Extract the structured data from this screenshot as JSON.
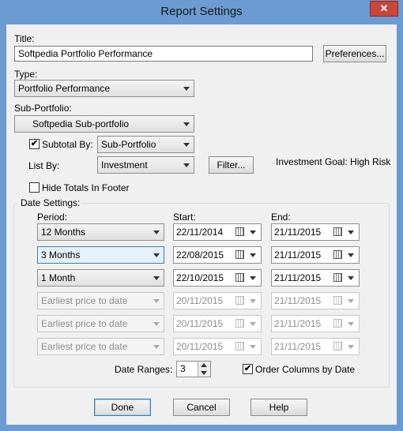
{
  "window": {
    "title": "Report Settings",
    "close_icon": "✕"
  },
  "title_field": {
    "label": "Title:",
    "value": "Softpedia Portfolio Performance",
    "preferences_button": "Preferences..."
  },
  "type_field": {
    "label": "Type:",
    "value": "Portfolio Performance"
  },
  "subportfolio_field": {
    "label": "Sub-Portfolio:",
    "value": "Softpedia Sub-portfolio"
  },
  "subtotal": {
    "checked_mark": "✔",
    "label": "Subtotal By:",
    "value": "Sub-Portfolio"
  },
  "listby": {
    "label": "List By:",
    "value": "Investment",
    "filter_button": "Filter...",
    "goal_text": "Investment Goal: High Risk"
  },
  "hide_totals": {
    "label": "Hide Totals In Footer"
  },
  "date_settings": {
    "group_title": "Date Settings:",
    "col_period": "Period:",
    "col_start": "Start:",
    "col_end": "End:",
    "rows": [
      {
        "period": "12 Months",
        "start": "22/11/2014",
        "end": "21/11/2015"
      },
      {
        "period": "3 Months",
        "start": "22/08/2015",
        "end": "21/11/2015"
      },
      {
        "period": "1 Month",
        "start": "22/10/2015",
        "end": "21/11/2015"
      },
      {
        "period": "Earliest price to date",
        "start": "20/11/2015",
        "end": "21/11/2015"
      },
      {
        "period": "Earliest price to date",
        "start": "20/11/2015",
        "end": "21/11/2015"
      },
      {
        "period": "Earliest price to date",
        "start": "20/11/2015",
        "end": "21/11/2015"
      }
    ],
    "date_ranges_label": "Date Ranges:",
    "date_ranges_value": "3",
    "order_columns_mark": "✔",
    "order_columns_label": "Order Columns by Date"
  },
  "footer": {
    "done": "Done",
    "cancel": "Cancel",
    "help": "Help"
  },
  "colors": {
    "titlebar": "#6b9bd1",
    "close": "#c9463d",
    "dialog_bg": "#f0f0f0"
  }
}
